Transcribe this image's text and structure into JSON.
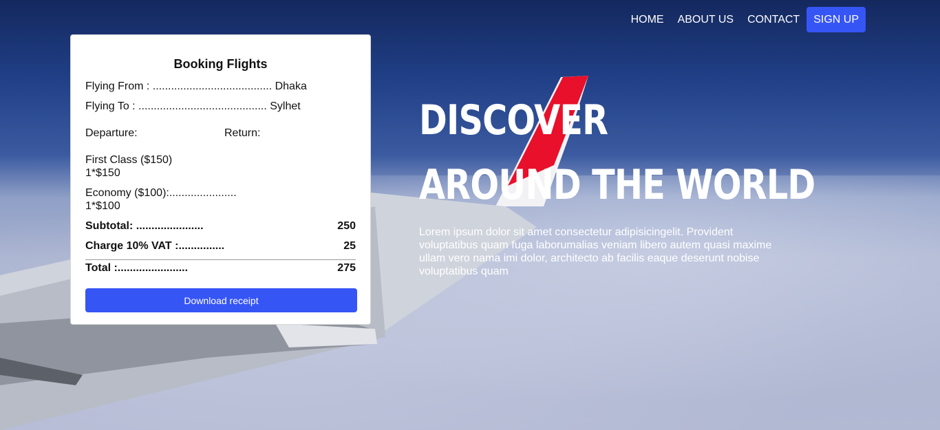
{
  "nav": {
    "items": [
      "HOME",
      "ABOUT US",
      "CONTACT"
    ],
    "signup": "SIGN UP"
  },
  "card": {
    "title": "Booking Flights",
    "flying_from": "Flying From : ....................................... Dhaka",
    "flying_to": "Flying To : .......................................... Sylhet",
    "departure": "Departure:",
    "return": "Return:",
    "first_class": "First Class ($150)",
    "first_class_qty": "1*$150",
    "economy": "Economy ($100):......................",
    "economy_qty": "1*$100",
    "subtotal_label": "Subtotal: ......................",
    "subtotal_value": "250",
    "vat_label": "Charge 10% VAT :...............",
    "vat_value": "25",
    "total_label": "Total :.......................",
    "total_value": "275",
    "button": "Download receipt"
  },
  "hero": {
    "title_line1": "DISCOVER",
    "title_line2": "AROUND THE WORLD",
    "text": "Lorem ipsum dolor sit amet consectetur adipisicingelit. Provident voluptatibus quam fuga laborumalias veniam libero autem quasi maxime ullam vero nama imi dolor, architecto ab facilis eaque deserunt nobise voluptatibus quam"
  },
  "colors": {
    "accent": "#3655f5",
    "sky_top": "#14285e",
    "tail_red": "#e8102a"
  }
}
